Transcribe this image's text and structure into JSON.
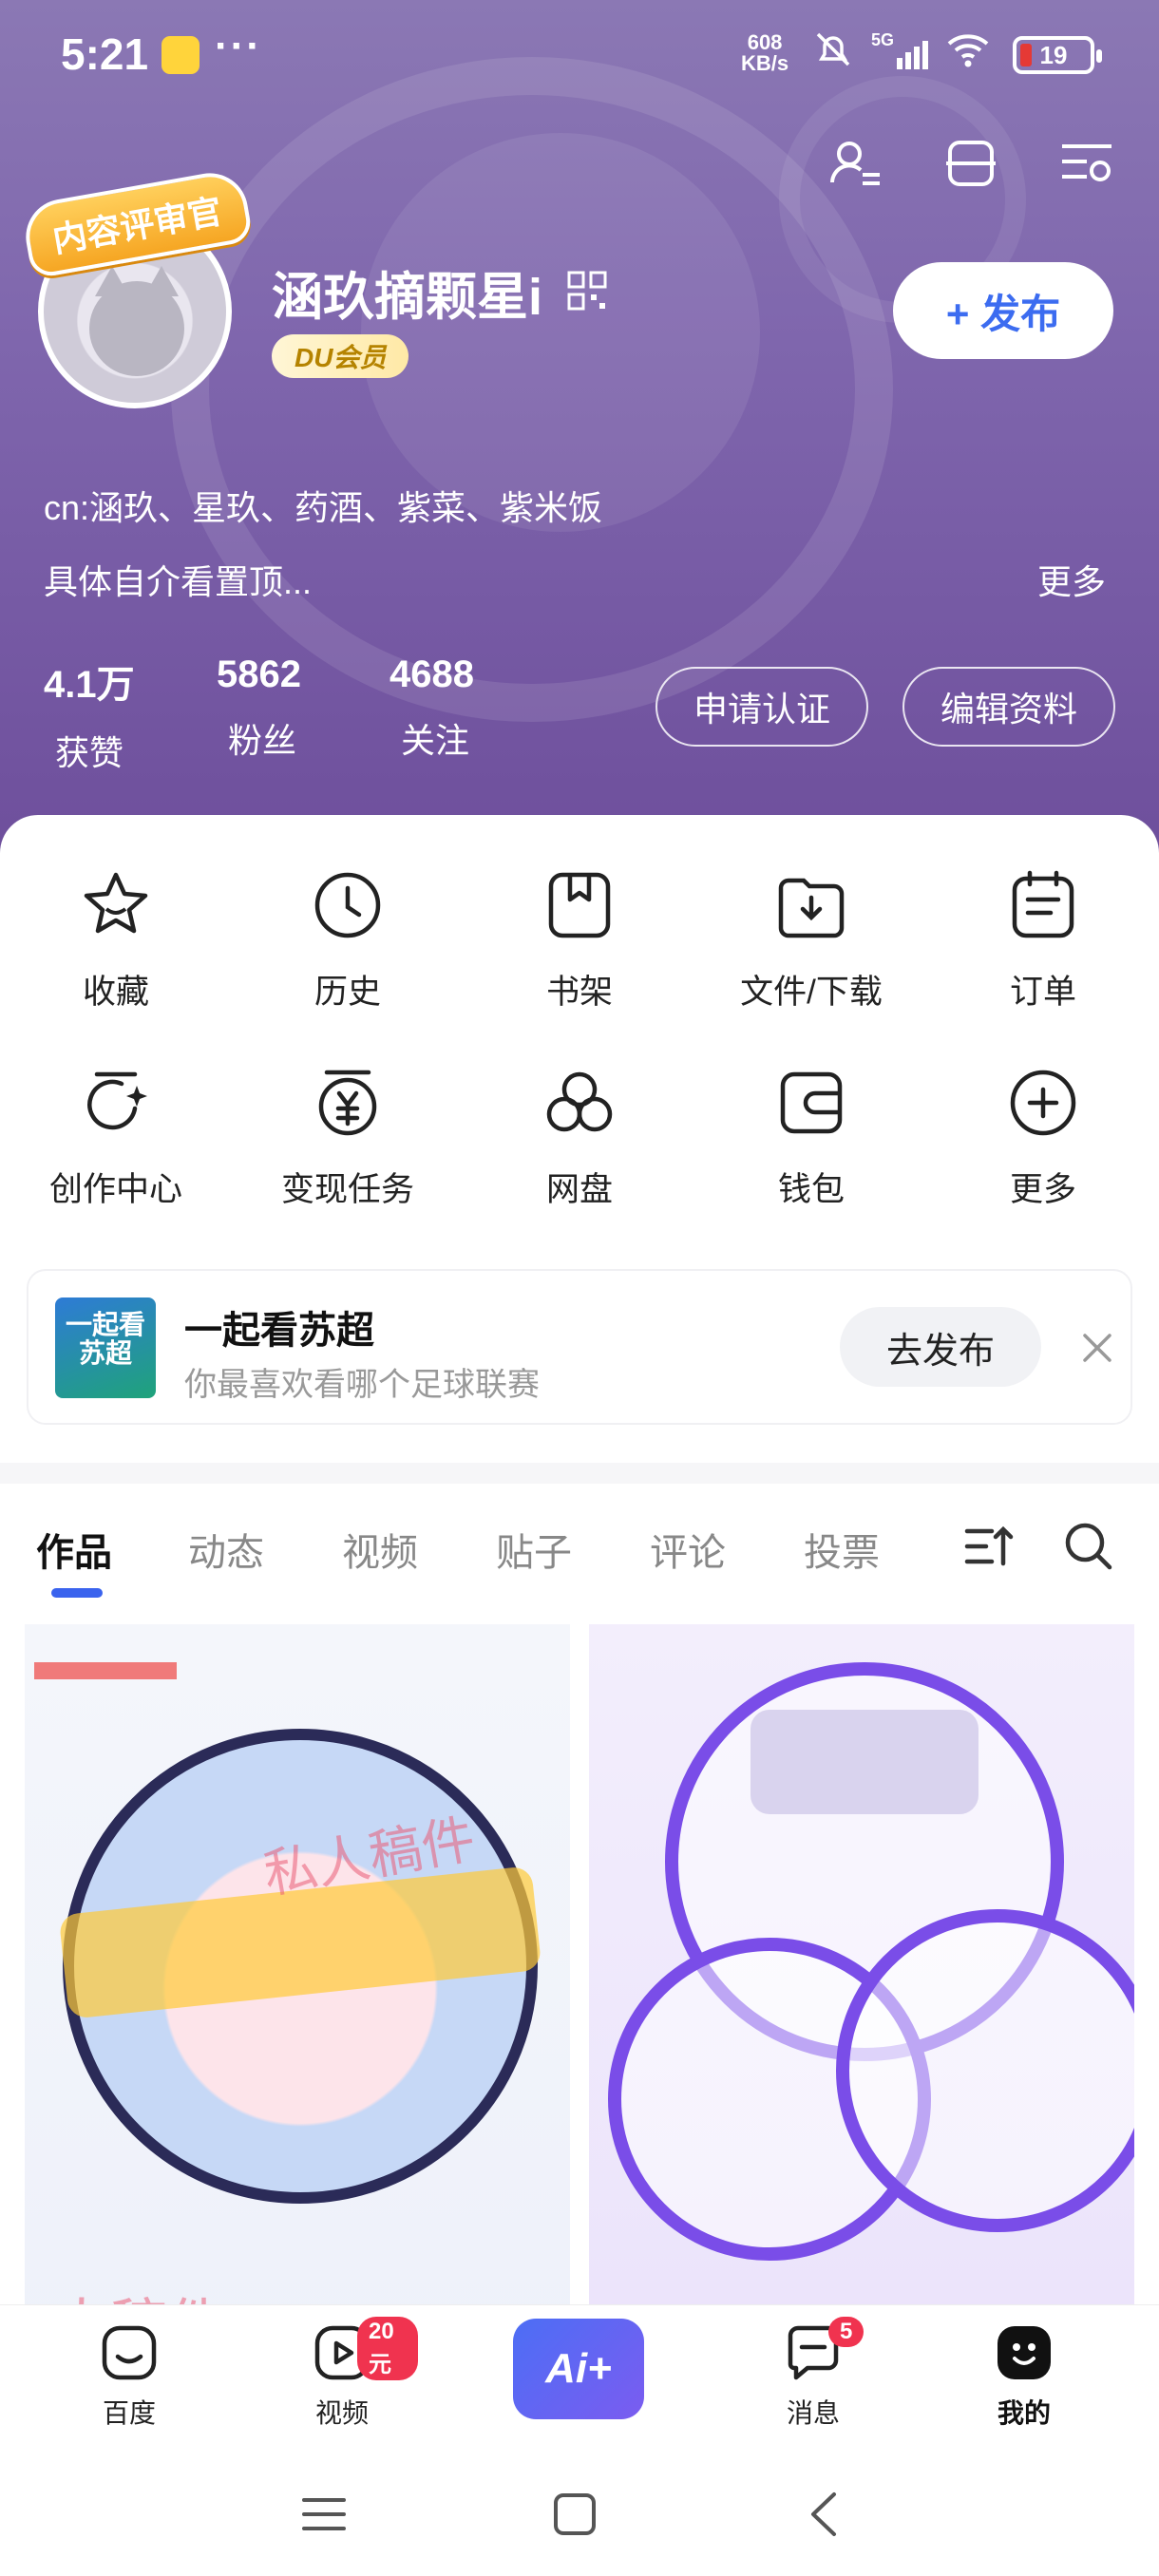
{
  "status_bar": {
    "time": "5:21",
    "dots": "···",
    "net_speed_value": "608",
    "net_speed_unit": "KB/s",
    "signal_label": "5G",
    "battery_level": "19"
  },
  "profile": {
    "name": "涵玖摘颗星i",
    "badge_text": "内容评审官",
    "vip_label": "DU会员",
    "publish_label": "+ 发布",
    "bio_line1": "cn:涵玖、星玖、药酒、紫菜、紫米饭",
    "bio_line2": "具体自介看置顶...",
    "more_label": "更多"
  },
  "stats": [
    {
      "value": "4.1万",
      "label": "获赞"
    },
    {
      "value": "5862",
      "label": "粉丝"
    },
    {
      "value": "4688",
      "label": "关注"
    }
  ],
  "actions": {
    "verify_label": "申请认证",
    "edit_label": "编辑资料"
  },
  "grid": [
    {
      "label": "收藏",
      "icon": "star-icon"
    },
    {
      "label": "历史",
      "icon": "clock-icon"
    },
    {
      "label": "书架",
      "icon": "bookshelf-icon"
    },
    {
      "label": "文件/下载",
      "icon": "download-icon"
    },
    {
      "label": "订单",
      "icon": "order-icon"
    },
    {
      "label": "创作中心",
      "icon": "creation-icon"
    },
    {
      "label": "变现任务",
      "icon": "money-icon"
    },
    {
      "label": "网盘",
      "icon": "cloud-drive-icon"
    },
    {
      "label": "钱包",
      "icon": "wallet-icon"
    },
    {
      "label": "更多",
      "icon": "plus-circle-icon"
    }
  ],
  "promo": {
    "thumb_text": "一起看苏超",
    "title": "一起看苏超",
    "subtitle": "你最喜欢看哪个足球联赛",
    "button_label": "去发布"
  },
  "tabs": [
    "作品",
    "动态",
    "视频",
    "贴子",
    "评论",
    "投票"
  ],
  "thumbs": {
    "wm1": "私人稿件",
    "wm2": "人稿件"
  },
  "bottom_nav": {
    "items": [
      {
        "label": "百度"
      },
      {
        "label": "视频",
        "badge": "20元"
      },
      {
        "label": "Ai+"
      },
      {
        "label": "消息",
        "badge": "5"
      },
      {
        "label": "我的"
      }
    ]
  },
  "colors": {
    "accent_blue": "#3a63ee",
    "header_purple": "#7f66ad",
    "badge_red": "#f0334f"
  }
}
